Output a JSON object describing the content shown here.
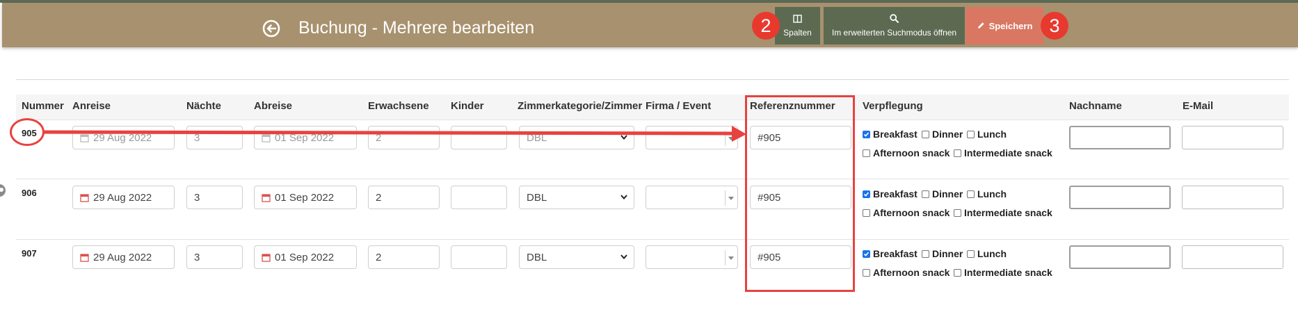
{
  "header": {
    "title": "Buchung - Mehrere bearbeiten",
    "columns_label": "Spalten",
    "search_label": "Im erweiterten Suchmodus öffnen",
    "save_label": "Speichern",
    "badge_columns": "2",
    "badge_save": "3",
    "bg_color": "#a8916e",
    "button_color": "#5d6a52",
    "save_color": "#d97762"
  },
  "table": {
    "headers": {
      "nummer": "Nummer",
      "anreise": "Anreise",
      "naechte": "Nächte",
      "abreise": "Abreise",
      "erwachsene": "Erwachsene",
      "kinder": "Kinder",
      "zimmer": "Zimmerkategorie/Zimmer",
      "firma": "Firma / Event",
      "referenz": "Referenznummer",
      "verpflegung": "Verpflegung",
      "nachname": "Nachname",
      "email": "E-Mail"
    },
    "meal_labels": {
      "breakfast": "Breakfast",
      "dinner": "Dinner",
      "lunch": "Lunch",
      "afternoon": "Afternoon snack",
      "intermediate": "Intermediate snack"
    },
    "rows": [
      {
        "nummer": "905",
        "anreise": "29 Aug 2022",
        "naechte": "3",
        "abreise": "01 Sep 2022",
        "erwachsene": "2",
        "kinder": "",
        "zimmer": "DBL",
        "firma": "",
        "referenz": "#905",
        "breakfast": true,
        "dinner": false,
        "lunch": false,
        "afternoon": false,
        "intermediate": false,
        "nachname": "",
        "email": ""
      },
      {
        "nummer": "906",
        "anreise": "29 Aug 2022",
        "naechte": "3",
        "abreise": "01 Sep 2022",
        "erwachsene": "2",
        "kinder": "",
        "zimmer": "DBL",
        "firma": "",
        "referenz": "#905",
        "breakfast": true,
        "dinner": false,
        "lunch": false,
        "afternoon": false,
        "intermediate": false,
        "nachname": "",
        "email": ""
      },
      {
        "nummer": "907",
        "anreise": "29 Aug 2022",
        "naechte": "3",
        "abreise": "01 Sep 2022",
        "erwachsene": "2",
        "kinder": "",
        "zimmer": "DBL",
        "firma": "",
        "referenz": "#905",
        "breakfast": true,
        "dinner": false,
        "lunch": false,
        "afternoon": false,
        "intermediate": false,
        "nachname": "",
        "email": ""
      }
    ]
  },
  "annotation": {
    "color": "#e8423e"
  }
}
